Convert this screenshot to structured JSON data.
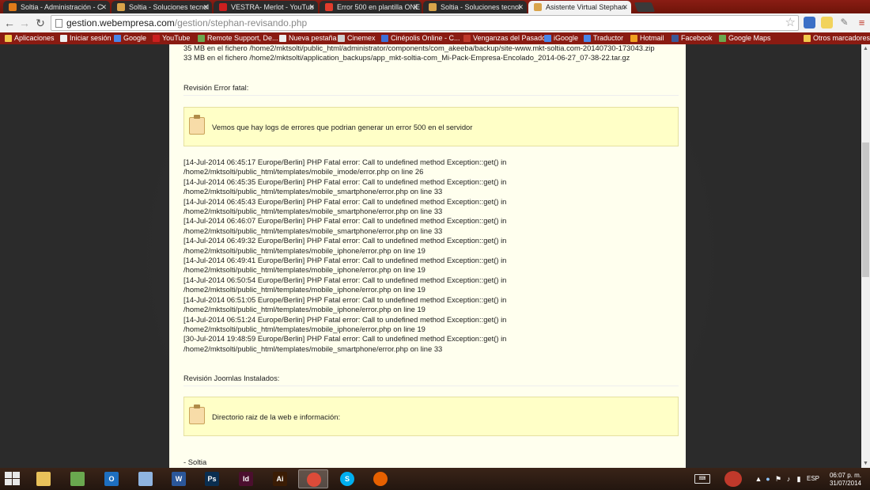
{
  "browser": {
    "tabs": [
      {
        "title": "Soltia - Administración - C",
        "favicon_color": "#e07b1a"
      },
      {
        "title": "Soltia - Soluciones tecnol",
        "favicon_color": "#d9a44a"
      },
      {
        "title": "VESTRA- Merlot - YouTub",
        "favicon_color": "#cc1f1f"
      },
      {
        "title": "Error 500 en plantilla ONE",
        "favicon_color": "#e23c2c"
      },
      {
        "title": "Soltia - Soluciones tecnol",
        "favicon_color": "#d9a44a"
      },
      {
        "title": "Asistente Virtual Stephan",
        "favicon_color": "#d9a44a"
      }
    ],
    "active_tab": 5,
    "url_host": "gestion.webempresa.com",
    "url_path": "/gestion/stephan-revisando.php",
    "bookmarks": [
      {
        "label": "Aplicaciones",
        "icon": "apps-grid-icon",
        "color": "#f2c94c"
      },
      {
        "label": "Iniciar sesión",
        "icon": "page-icon",
        "color": "#eeeeee"
      },
      {
        "label": "Google",
        "icon": "google-icon",
        "color": "#4a86e8"
      },
      {
        "label": "YouTube",
        "icon": "youtube-icon",
        "color": "#cc1f1f"
      },
      {
        "label": "Remote Support, De...",
        "icon": "support-icon",
        "color": "#6aa84f"
      },
      {
        "label": "Nueva pestaña",
        "icon": "page-icon",
        "color": "#eeeeee"
      },
      {
        "label": "Cinemex",
        "icon": "cinemex-icon",
        "color": "#cfcfcf"
      },
      {
        "label": "Cinépolis Online - C...",
        "icon": "cinepolis-icon",
        "color": "#3d6fd8"
      },
      {
        "label": "Venganzas del Pasado",
        "icon": "venganzas-icon",
        "color": "#c0392b"
      },
      {
        "label": "iGoogle",
        "icon": "google-icon",
        "color": "#4a86e8"
      },
      {
        "label": "Traductor",
        "icon": "translate-icon",
        "color": "#4a86e8"
      },
      {
        "label": "Hotmail",
        "icon": "windows-icon",
        "color": "#f0a020"
      },
      {
        "label": "Facebook",
        "icon": "facebook-icon",
        "color": "#3b5998"
      },
      {
        "label": "Google Maps",
        "icon": "maps-icon",
        "color": "#6aa84f"
      }
    ],
    "other_bookmarks": "Otros marcadores"
  },
  "page": {
    "backup_lines": [
      "35 MB en el fichero /home2/mktsolti/public_html/administrator/components/com_akeeba/backup/site-www.mkt-soltia.com-20140730-173043.zip",
      "33 MB en el fichero /home2/mktsolti/application_backups/app_mkt-soltia-com_Mi-Pack-Empresa-Encolado_2014-06-27_07-38-22.tar.gz"
    ],
    "section_error_title": "Revisión Error fatal:",
    "note_error": "Vemos que hay logs de errores que podrian generar un error 500 en el servidor",
    "log_lines": [
      "[14-Jul-2014 06:45:17 Europe/Berlin] PHP Fatal error: Call to undefined method Exception::get() in",
      "/home2/mktsolti/public_html/templates/mobile_imode/error.php on line 26",
      "[14-Jul-2014 06:45:35 Europe/Berlin] PHP Fatal error: Call to undefined method Exception::get() in",
      "/home2/mktsolti/public_html/templates/mobile_smartphone/error.php on line 33",
      "[14-Jul-2014 06:45:43 Europe/Berlin] PHP Fatal error: Call to undefined method Exception::get() in",
      "/home2/mktsolti/public_html/templates/mobile_smartphone/error.php on line 33",
      "[14-Jul-2014 06:46:07 Europe/Berlin] PHP Fatal error: Call to undefined method Exception::get() in",
      "/home2/mktsolti/public_html/templates/mobile_smartphone/error.php on line 33",
      "[14-Jul-2014 06:49:32 Europe/Berlin] PHP Fatal error: Call to undefined method Exception::get() in",
      "/home2/mktsolti/public_html/templates/mobile_iphone/error.php on line 19",
      "[14-Jul-2014 06:49:41 Europe/Berlin] PHP Fatal error: Call to undefined method Exception::get() in",
      "/home2/mktsolti/public_html/templates/mobile_iphone/error.php on line 19",
      "[14-Jul-2014 06:50:54 Europe/Berlin] PHP Fatal error: Call to undefined method Exception::get() in",
      "/home2/mktsolti/public_html/templates/mobile_iphone/error.php on line 19",
      "[14-Jul-2014 06:51:05 Europe/Berlin] PHP Fatal error: Call to undefined method Exception::get() in",
      "/home2/mktsolti/public_html/templates/mobile_iphone/error.php on line 19",
      "[14-Jul-2014 06:51:24 Europe/Berlin] PHP Fatal error: Call to undefined method Exception::get() in",
      "/home2/mktsolti/public_html/templates/mobile_iphone/error.php on line 19",
      "[30-Jul-2014 19:48:59 Europe/Berlin] PHP Fatal error: Call to undefined method Exception::get() in",
      "/home2/mktsolti/public_html/templates/mobile_smartphone/error.php on line 33"
    ],
    "section_joomla_title": "Revisión Joomlas Instalados:",
    "note_joomla": "Directorio raiz de la web e información:",
    "signature": "- Soltia"
  },
  "taskbar": {
    "apps": [
      {
        "name": "file-explorer-icon",
        "glyph": "",
        "color": "#e8c15a"
      },
      {
        "name": "apps-store-icon",
        "glyph": "",
        "color": "#6aa84f"
      },
      {
        "name": "outlook-icon",
        "glyph": "O",
        "color": "#1e6fc0"
      },
      {
        "name": "paint-icon",
        "glyph": "",
        "color": "#8fb4e0"
      },
      {
        "name": "word-icon",
        "glyph": "W",
        "color": "#2b579a"
      },
      {
        "name": "photoshop-icon",
        "glyph": "Ps",
        "color": "#0a2e50"
      },
      {
        "name": "indesign-icon",
        "glyph": "Id",
        "color": "#4b0f2e"
      },
      {
        "name": "illustrator-icon",
        "glyph": "Ai",
        "color": "#3b1c04"
      },
      {
        "name": "chrome-icon",
        "glyph": "",
        "color": "#dd4b39"
      },
      {
        "name": "skype-icon",
        "glyph": "S",
        "color": "#00aff0"
      },
      {
        "name": "firefox-icon",
        "glyph": "",
        "color": "#e66000"
      }
    ],
    "active_app": 8,
    "language": "ESP",
    "time": "06:07 p. m.",
    "date": "31/07/2014"
  }
}
